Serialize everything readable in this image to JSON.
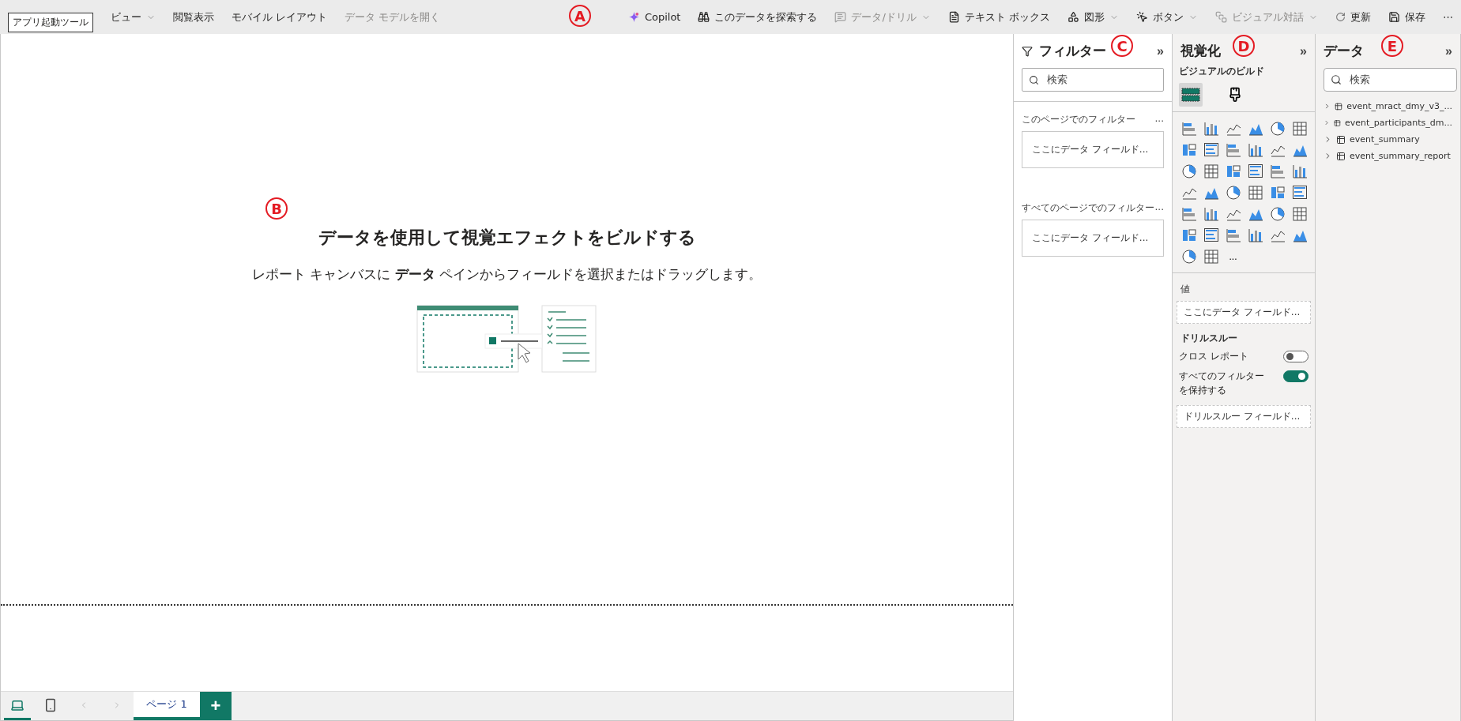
{
  "callouts": [
    {
      "label": "A"
    },
    {
      "label": "B"
    },
    {
      "label": "C"
    },
    {
      "label": "D"
    },
    {
      "label": "E"
    }
  ],
  "toolbar": {
    "tooltip": "アプリ起動ツール",
    "left": [
      {
        "label": "ビュー",
        "dropdown": true,
        "disabled": false
      },
      {
        "label": "閲覧表示",
        "dropdown": false,
        "disabled": false
      },
      {
        "label": "モバイル レイアウト",
        "dropdown": false,
        "disabled": false
      },
      {
        "label": "データ モデルを開く",
        "dropdown": false,
        "disabled": true
      }
    ],
    "right": [
      {
        "label": "Copilot",
        "dropdown": false,
        "disabled": false
      },
      {
        "label": "このデータを探索する",
        "dropdown": false,
        "disabled": false
      },
      {
        "label": "データ/ドリル",
        "dropdown": true,
        "disabled": true
      },
      {
        "label": "テキスト ボックス",
        "dropdown": false,
        "disabled": false
      },
      {
        "label": "図形",
        "dropdown": true,
        "disabled": false
      },
      {
        "label": "ボタン",
        "dropdown": true,
        "disabled": false
      },
      {
        "label": "ビジュアル対話",
        "dropdown": true,
        "disabled": true
      },
      {
        "label": "更新",
        "dropdown": false,
        "disabled": false
      },
      {
        "label": "保存",
        "dropdown": false,
        "disabled": false
      }
    ],
    "more": "⋯"
  },
  "canvas": {
    "heading": "データを使用して視覚エフェクトをビルドする",
    "subtitle": "レポート キャンバスに **データ** ペインからフィールドを選択またはドラッグします。"
  },
  "filters": {
    "title": "フィルター",
    "collapse": "»",
    "search": {
      "placeholder": "検索"
    },
    "sections": [
      {
        "title": "このページでのフィルター",
        "more": "...",
        "drop": "ここにデータ フィールド..."
      },
      {
        "title": "すべてのページでのフィルター",
        "more": "...",
        "drop": "ここにデータ フィールド..."
      }
    ]
  },
  "visualizations": {
    "title": "視覚化",
    "collapse": "»",
    "subtitle": "ビジュアルのビルド",
    "tabs": [
      {
        "selected": true
      },
      {
        "selected": false
      }
    ],
    "more": "...",
    "values_label": "値",
    "values_drop": "ここにデータ フィールド...",
    "drill_title": "ドリルスルー",
    "toggles": [
      {
        "label": "クロス レポート",
        "on": false
      },
      {
        "label": "すべてのフィルターを保持する",
        "on": true
      }
    ],
    "drill_drop": "ドリルスルー フィールド..."
  },
  "data": {
    "title": "データ",
    "collapse": "»",
    "search": {
      "placeholder": "検索"
    },
    "tables": [
      {
        "name": "event_mract_dmy_v3_...",
        "expanded": false
      },
      {
        "name": "event_participants_dm...",
        "expanded": false
      },
      {
        "name": "event_summary",
        "expanded": false
      },
      {
        "name": "event_summary_report",
        "expanded": false
      }
    ]
  },
  "footer": {
    "views": [
      {
        "selected": true
      },
      {
        "selected": false
      }
    ],
    "pages": [
      {
        "label": "ページ 1",
        "selected": true
      }
    ],
    "add": "+"
  }
}
